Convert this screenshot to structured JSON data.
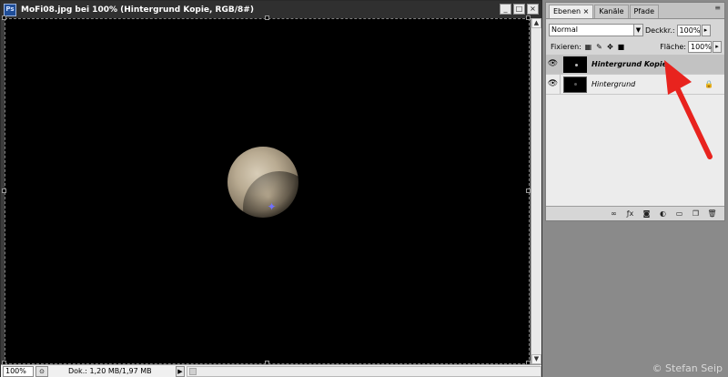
{
  "document": {
    "app_icon": "Ps",
    "title": "MoFi08.jpg bei 100% (Hintergrund Kopie, RGB/8#)",
    "controls": {
      "minimize": "_",
      "maximize": "□",
      "close": "×"
    }
  },
  "statusbar": {
    "zoom": "100%",
    "doc_info": "Dok.: 1,20 MB/1,97 MB",
    "arrow": "▶"
  },
  "layers_panel": {
    "tabs": [
      {
        "label": "Ebenen ×"
      },
      {
        "label": "Kanäle"
      },
      {
        "label": "Pfade"
      }
    ],
    "close_glyph": "×",
    "blend_mode": "Normal",
    "opacity_label": "Deckkr.:",
    "opacity_value": "100%",
    "lock_label": "Fixieren:",
    "fill_label": "Fläche:",
    "fill_value": "100%",
    "layers": [
      {
        "name": "Hintergrund Kopie",
        "visible": true,
        "selected": true
      },
      {
        "name": "Hintergrund",
        "visible": true,
        "selected": false,
        "locked": true
      }
    ],
    "footer_icons": [
      "link-icon",
      "fx-icon",
      "mask-icon",
      "adjustment-icon",
      "group-icon",
      "new-layer-icon",
      "trash-icon"
    ]
  },
  "watermark": "© Stefan Seip",
  "colors": {
    "accent_arrow": "#e8231e",
    "canvas_bg": "#000000"
  }
}
